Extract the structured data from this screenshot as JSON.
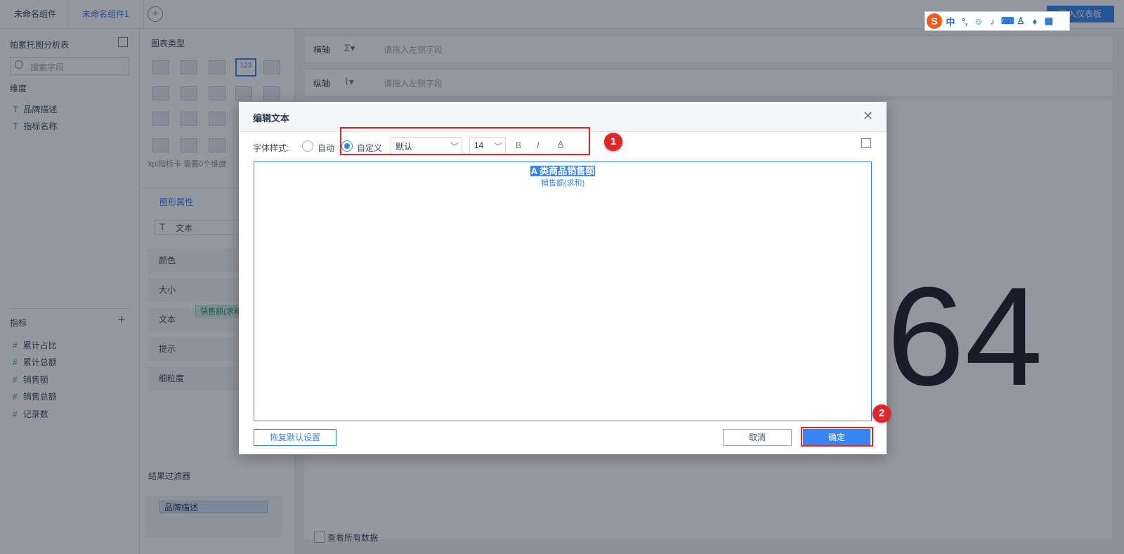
{
  "tabs": [
    {
      "label": "未命名组件",
      "active": false
    },
    {
      "label": "未命名组件1",
      "active": true
    }
  ],
  "add_tab_label": "+",
  "header": {
    "enter_dashboard": "进入仪表板"
  },
  "ime_toolbar": {
    "lang": "中",
    "punct": "°,"
  },
  "data_panel": {
    "title": "帕累托图分析表",
    "search_placeholder": "搜索字段",
    "dimension_label": "维度",
    "dimensions": [
      "品牌描述",
      "指标名称"
    ],
    "measure_label": "指标",
    "measures": [
      "累计占比",
      "累计总额",
      "销售额",
      "销售总额",
      "记录数"
    ]
  },
  "chart_panel": {
    "title": "图表类型",
    "hint": "kpi指标卡 需要0个维度",
    "selected_icon_text": "123",
    "tab_graph_props": "图形属性",
    "text_row": "文本",
    "props": [
      "颜色",
      "大小",
      "文本",
      "提示",
      "细粒度"
    ],
    "text_field_pill": "销售额(求和)",
    "result_filter": "结果过滤器",
    "filter_pill": "品牌描述"
  },
  "axes": {
    "x_label": "横轴",
    "y_label": "纵轴",
    "placeholder": "请拖入左侧字段"
  },
  "canvas": {
    "big_number": "64",
    "view_all_label": "查看所有数据"
  },
  "dialog": {
    "title": "编辑文本",
    "font_style_label": "字体样式:",
    "radio_auto": "自动",
    "radio_custom": "自定义",
    "font_family_value": "默认",
    "font_size_value": "14",
    "bold_icon": "B",
    "italic_icon": "I",
    "underline_icon": "A",
    "text_line1": "A 类商品销售额",
    "text_line2": "销售额(求和)",
    "reset_button": "恢复默认设置",
    "cancel_button": "取消",
    "ok_button": "确定"
  },
  "annotations": {
    "badge1": "1",
    "badge2": "2"
  },
  "colors": {
    "accent": "#3685f2",
    "annotation_red": "#e02626"
  }
}
